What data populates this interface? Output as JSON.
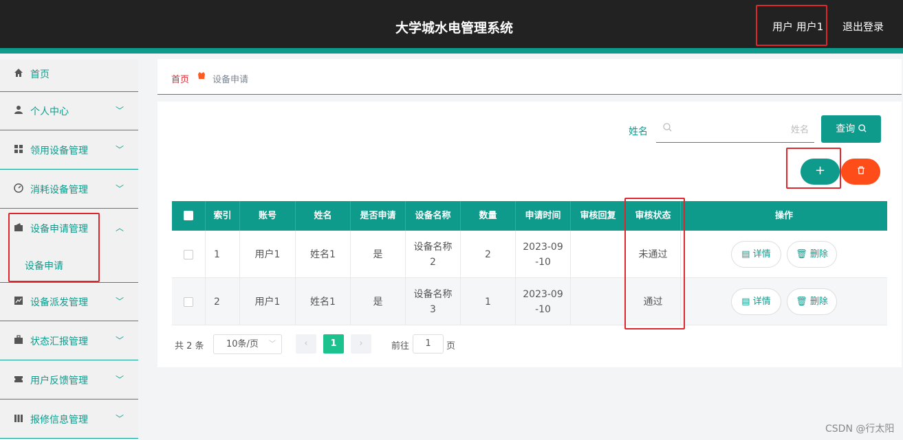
{
  "header": {
    "title": "大学城水电管理系统",
    "user_label": "用户 用户1",
    "logout": "退出登录"
  },
  "sidebar": {
    "items": [
      {
        "label": "首页",
        "icon": "home-icon"
      },
      {
        "label": "个人中心",
        "icon": "user-icon"
      },
      {
        "label": "领用设备管理",
        "icon": "grid-icon"
      },
      {
        "label": "消耗设备管理",
        "icon": "gauge-icon"
      },
      {
        "label": "设备申请管理",
        "icon": "wallet-icon",
        "expanded": true,
        "children": [
          "设备申请"
        ]
      },
      {
        "label": "设备派发管理",
        "icon": "chart-icon"
      },
      {
        "label": "状态汇报管理",
        "icon": "briefcase-icon"
      },
      {
        "label": "用户反馈管理",
        "icon": "ticket-icon"
      },
      {
        "label": "报修信息管理",
        "icon": "columns-icon"
      }
    ]
  },
  "breadcrumb": {
    "home": "首页",
    "current": "设备申请"
  },
  "search": {
    "label": "姓名",
    "placeholder": "姓名",
    "button": "查询"
  },
  "actions": {
    "add": "+",
    "delete": "🗑"
  },
  "table": {
    "headers": [
      "",
      "索引",
      "账号",
      "姓名",
      "是否申请",
      "设备名称",
      "数量",
      "申请时间",
      "审核回复",
      "审核状态",
      "操作"
    ],
    "rows": [
      {
        "index": "1",
        "account": "用户1",
        "name": "姓名1",
        "applied": "是",
        "device": "设备名称2",
        "qty": "2",
        "time": "2023-09-10",
        "reply": "",
        "status": "未通过"
      },
      {
        "index": "2",
        "account": "用户1",
        "name": "姓名1",
        "applied": "是",
        "device": "设备名称3",
        "qty": "1",
        "time": "2023-09-10",
        "reply": "",
        "status": "通过"
      }
    ],
    "detail_btn": "详情",
    "delete_btn": "删除"
  },
  "pagination": {
    "total": "共 2 条",
    "page_size": "10条/页",
    "current_page": "1",
    "goto_label": "前往",
    "goto_value": "1",
    "page_suffix": "页"
  },
  "watermark": "CSDN @行太阳",
  "colors": {
    "primary": "#0f9b8c",
    "danger": "#ff4d1a",
    "highlight": "#e0262d",
    "header_bg": "#222222"
  }
}
